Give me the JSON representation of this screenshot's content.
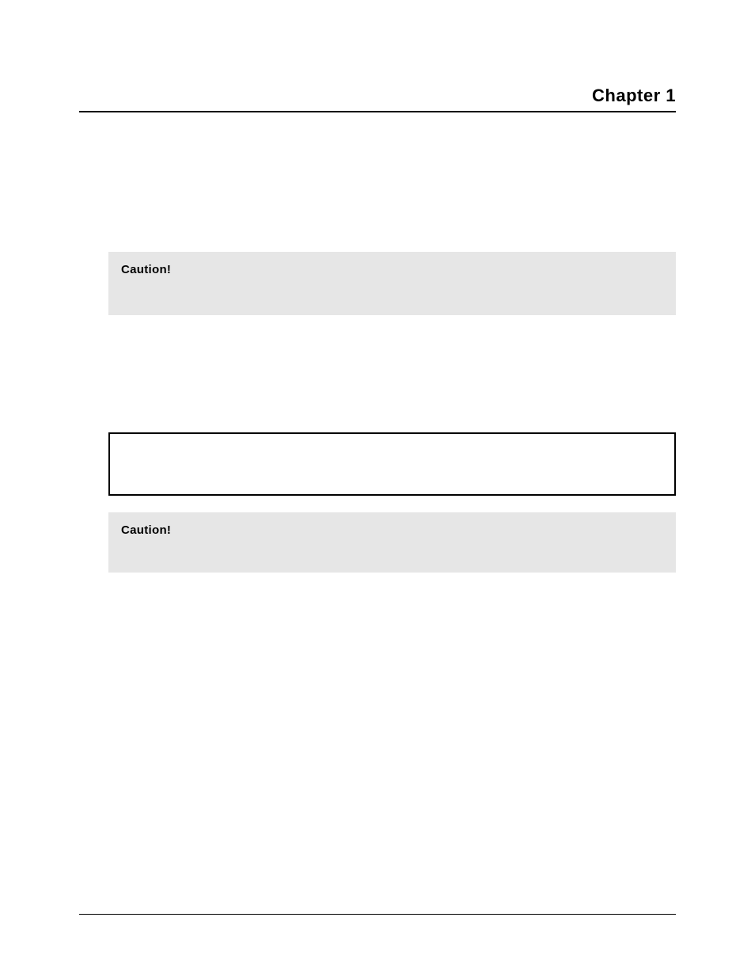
{
  "header": {
    "chapter_label": "Chapter 1"
  },
  "caution1": {
    "label": "Caution!"
  },
  "caution2": {
    "label": "Caution!"
  }
}
